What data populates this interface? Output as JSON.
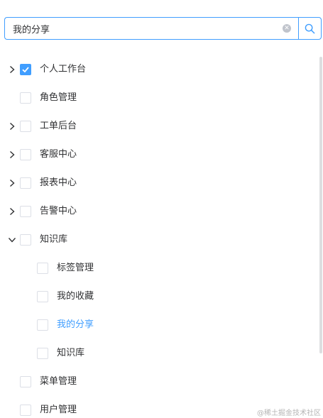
{
  "search": {
    "value": "我的分享",
    "clear_icon": "circle-close-icon",
    "search_icon": "search-icon"
  },
  "tree": [
    {
      "label": "个人工作台",
      "level": 0,
      "arrow": "chevron-right",
      "checked": true,
      "active": false
    },
    {
      "label": "角色管理",
      "level": 0,
      "arrow": "",
      "checked": false,
      "active": false
    },
    {
      "label": "工单后台",
      "level": 0,
      "arrow": "chevron-right",
      "checked": false,
      "active": false
    },
    {
      "label": "客服中心",
      "level": 0,
      "arrow": "chevron-right",
      "checked": false,
      "active": false
    },
    {
      "label": "报表中心",
      "level": 0,
      "arrow": "chevron-right",
      "checked": false,
      "active": false
    },
    {
      "label": "告警中心",
      "level": 0,
      "arrow": "chevron-right",
      "checked": false,
      "active": false
    },
    {
      "label": "知识库",
      "level": 0,
      "arrow": "chevron-down",
      "checked": false,
      "active": false
    },
    {
      "label": "标签管理",
      "level": 1,
      "arrow": "",
      "checked": false,
      "active": false
    },
    {
      "label": "我的收藏",
      "level": 1,
      "arrow": "",
      "checked": false,
      "active": false
    },
    {
      "label": "我的分享",
      "level": 1,
      "arrow": "",
      "checked": false,
      "active": true
    },
    {
      "label": "知识库",
      "level": 1,
      "arrow": "",
      "checked": false,
      "active": false
    },
    {
      "label": "菜单管理",
      "level": 0,
      "arrow": "",
      "checked": false,
      "active": false
    },
    {
      "label": "用户管理",
      "level": 0,
      "arrow": "",
      "checked": false,
      "active": false
    }
  ],
  "colors": {
    "accent": "#409eff",
    "text": "#303133",
    "border": "#dcdfe6"
  },
  "watermark": "@稀土掘金技术社区"
}
